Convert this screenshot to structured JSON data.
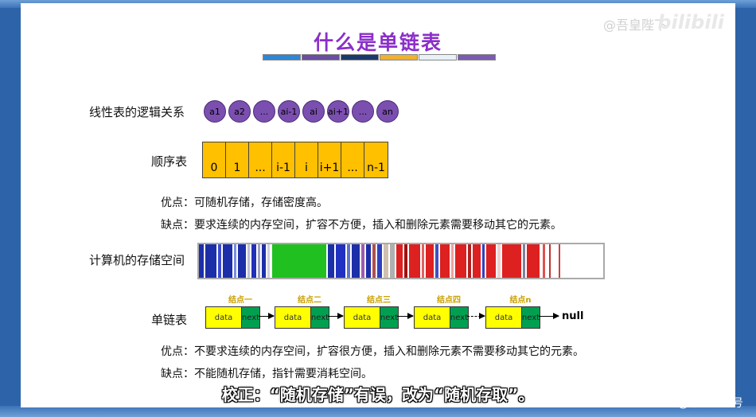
{
  "slide_title": "什么是单链表",
  "watermark": "@吾皇陛下",
  "bili_logo": "bilibili",
  "color_bar": [
    "#2e86d4",
    "#6a4ea0",
    "#1b3a6b",
    "#f0b030",
    "#e8f0f8",
    "#7a5cb0"
  ],
  "logic": {
    "label": "线性表的逻辑关系",
    "items": [
      "a1",
      "a2",
      "...",
      "ai-1",
      "ai",
      "ai+1",
      "...",
      "an"
    ]
  },
  "sequential": {
    "label": "顺序表",
    "cells": [
      "0",
      "1",
      "...",
      "i-1",
      "i",
      "i+1",
      "...",
      "n-1"
    ]
  },
  "seq_pros": "优点：可随机存储，存储密度高。",
  "seq_cons": "缺点：要求连续的内存空间，扩容不方便，插入和删除元素需要移动其它的元素。",
  "memory": {
    "label": "计算机的存储空间"
  },
  "linked": {
    "label": "单链表",
    "nodes": [
      {
        "title": "结点一",
        "data": "data",
        "next": "next"
      },
      {
        "title": "结点二",
        "data": "data",
        "next": "next"
      },
      {
        "title": "结点三",
        "data": "data",
        "next": "next"
      },
      {
        "title": "结点四",
        "data": "data",
        "next": "next"
      },
      {
        "title": "结点n",
        "data": "data",
        "next": "next"
      }
    ],
    "null_label": "null"
  },
  "link_pros": "优点：不要求连续的内存空间，扩容很方便，插入和删除元素不需要移动其它的元素。",
  "link_cons": "缺点：不能随机存储，指针需要消耗空间。",
  "subtitle": "校正：“随机存储”有误，改为“随机存取”。",
  "csdn": "CSDN @菜鸟550号"
}
